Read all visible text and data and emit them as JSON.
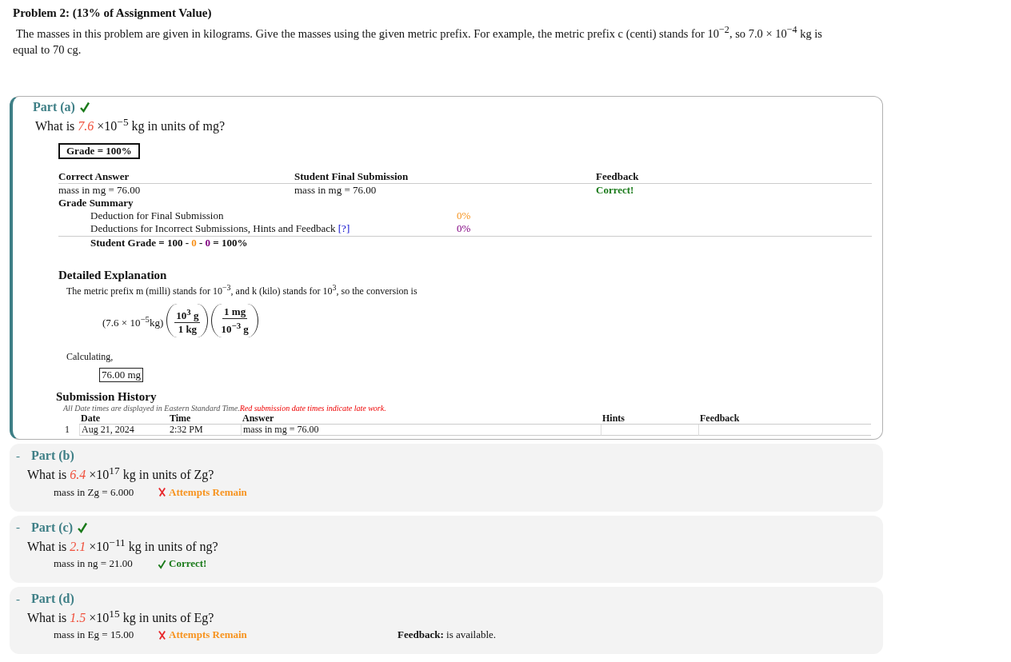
{
  "problem": {
    "title": "Problem 2: (13% of Assignment Value)",
    "intro": "The masses in this problem are given in kilograms. Give the masses using the given metric prefix. For example, the metric prefix c (centi) stands for 10$^{−2}$, so 7.0 × 10$^{−4}$ kg is equal to 70 cg."
  },
  "parts": [
    {
      "kind": "expanded",
      "label": "Part (a)",
      "correct": true,
      "question": "What is *7.6* ×10$^{−5}$ kg in units of mg?",
      "details": {
        "grade": "Grade = 100%",
        "answer_table": {
          "columns": [
            "Correct Answer",
            "Student Final Submission",
            "Feedback"
          ],
          "cells": [
            "mass in mg = 76.00",
            "mass in mg = 76.00",
            "Correct!"
          ]
        },
        "grade_summary": {
          "title": "Grade Summary",
          "rows": [
            {
              "label": "Deduction for Final Submission",
              "value": "0%"
            },
            {
              "label": "Deductions for Incorrect Submissions, Hints and Feedback",
              "link": "[?]",
              "value": "0%"
            }
          ],
          "total": {
            "prefix": "Student Grade = 100",
            "sep": "-",
            "d1": "0",
            "d2": "0",
            "suffix": "= 100%"
          }
        },
        "explanation": {
          "title": "Detailed Explanation",
          "text": "The metric prefix m (milli) stands for 10$^{−3}$, and k (kilo) stands for 10$^{3}$, so the conversion is",
          "lead": "(7.6 × 10$^{−5}$kg)",
          "fractions": [
            {
              "num": "10$^{3}$ g",
              "den": "1 kg"
            },
            {
              "num": "1 mg",
              "den": "10$^{−3}$ g"
            }
          ],
          "calc_label": "Calculating,",
          "result": "76.00 mg"
        },
        "history": {
          "title": "Submission History",
          "note": "All Date times are displayed in Eastern Standard Time.",
          "late_note": "Red submission date times indicate late work.",
          "columns": [
            "Date",
            "Time",
            "Answer",
            "Hints",
            "Feedback"
          ],
          "rows": [
            {
              "index": "1",
              "date": "Aug 21, 2024",
              "time": "2:32 PM",
              "answer": "mass in mg = 76.00",
              "late": false
            }
          ]
        }
      }
    },
    {
      "kind": "collapsed",
      "marker": "-",
      "label": "Part (b)",
      "correct": false,
      "question": "What is *6.4* ×10$^{17}$ kg in units of Zg?",
      "answer": "mass in Zg = 6.000",
      "status": {
        "kind": "wrong",
        "text": "Attempts Remain"
      }
    },
    {
      "kind": "collapsed",
      "marker": "-",
      "label": "Part (c)",
      "correct": true,
      "question": "What is *2.1* ×10$^{−11}$ kg in units of ng?",
      "answer": "mass in ng = 21.00",
      "status": {
        "kind": "right",
        "text": "Correct!"
      }
    },
    {
      "kind": "collapsed",
      "marker": "-",
      "label": "Part (d)",
      "correct": false,
      "question": "What is *1.5* ×10$^{15}$ kg in units of Eg?",
      "answer": "mass in Eg = 15.00",
      "status": {
        "kind": "wrong",
        "text": "Attempts Remain"
      },
      "feedback": {
        "label": "Feedback:",
        "text": "is available."
      }
    }
  ]
}
